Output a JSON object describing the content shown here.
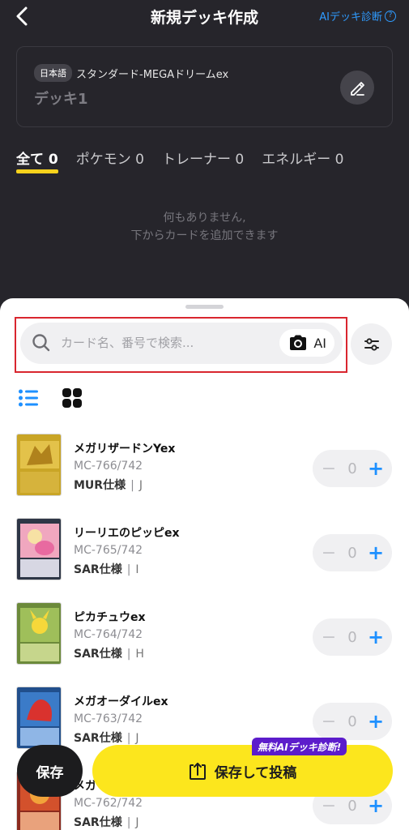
{
  "header": {
    "title": "新規デッキ作成",
    "ai_diagnosis": "AIデッキ診断"
  },
  "deck": {
    "language": "日本語",
    "format": "スタンダード-MEGAドリームex",
    "name": "デッキ1"
  },
  "tabs": [
    {
      "label": "全て 0",
      "active": true
    },
    {
      "label": "ポケモン 0",
      "active": false
    },
    {
      "label": "トレーナー 0",
      "active": false
    },
    {
      "label": "エネルギー 0",
      "active": false
    }
  ],
  "empty_message": {
    "line1": "何もありません,",
    "line2": "下からカードを追加できます"
  },
  "search": {
    "placeholder": "カード名、番号で検索...",
    "ai_label": "AI"
  },
  "cards": [
    {
      "name": "メガリザードンYex",
      "number": "MC-766/742",
      "rarity": "MUR仕様",
      "mark": "J",
      "count": "0"
    },
    {
      "name": "リーリエのピッピex",
      "number": "MC-765/742",
      "rarity": "SAR仕様",
      "mark": "I",
      "count": "0"
    },
    {
      "name": "ピカチュウex",
      "number": "MC-764/742",
      "rarity": "SAR仕様",
      "mark": "H",
      "count": "0"
    },
    {
      "name": "メガオーダイルex",
      "number": "MC-763/742",
      "rarity": "SAR仕様",
      "mark": "J",
      "count": "0"
    },
    {
      "name": "メガ",
      "number": "MC-762/742",
      "rarity": "SAR仕様",
      "mark": "J",
      "count": "0"
    }
  ],
  "stepper": {
    "minus": "−",
    "plus": "+"
  },
  "actions": {
    "save": "保存",
    "save_post": "保存して投稿",
    "free_ai_badge": "無料AIデッキ診断!"
  },
  "colors": {
    "background": "#26252b",
    "accent_yellow": "#fce61d",
    "accent_blue": "#1e90ff",
    "badge_purple": "#5c1ccb",
    "highlight_red": "#d9262f"
  }
}
